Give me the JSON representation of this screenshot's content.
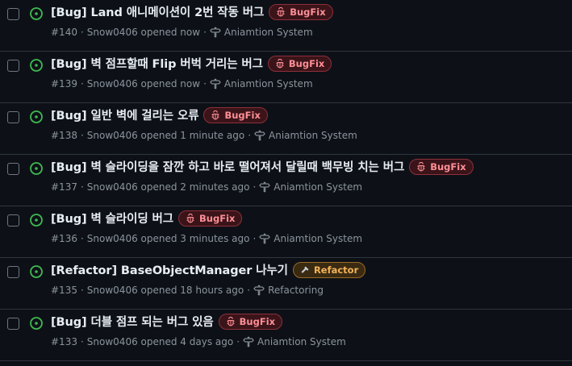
{
  "issues": [
    {
      "title": "[Bug] Land 애니메이션이 2번 작동 버그",
      "label": "BugFix",
      "label_type": "bug",
      "number": "#140",
      "opened_by": "Snow0406 opened now",
      "milestone": "Aniamtion System"
    },
    {
      "title": "[Bug] 벽 점프할때 Flip 버벅 거리는 버그",
      "label": "BugFix",
      "label_type": "bug",
      "number": "#139",
      "opened_by": "Snow0406 opened now",
      "milestone": "Aniamtion System"
    },
    {
      "title": "[Bug] 일반 벽에 걸리는 오류",
      "label": "BugFix",
      "label_type": "bug",
      "number": "#138",
      "opened_by": "Snow0406 opened 1 minute ago",
      "milestone": "Aniamtion System"
    },
    {
      "title": "[Bug] 벽 슬라이딩을 잠깐 하고 바로 떨어져서 달릴때 백무빙 치는 버그",
      "label": "BugFix",
      "label_type": "bug",
      "number": "#137",
      "opened_by": "Snow0406 opened 2 minutes ago",
      "milestone": "Aniamtion System"
    },
    {
      "title": "[Bug] 벽 슬라이딩 버그",
      "label": "BugFix",
      "label_type": "bug",
      "number": "#136",
      "opened_by": "Snow0406 opened 3 minutes ago",
      "milestone": "Aniamtion System"
    },
    {
      "title": "[Refactor] BaseObjectManager 나누기",
      "label": "Refactor",
      "label_type": "refactor",
      "number": "#135",
      "opened_by": "Snow0406 opened 18 hours ago",
      "milestone": "Refactoring"
    },
    {
      "title": "[Bug] 더블 점프 되는 버그 있음",
      "label": "BugFix",
      "label_type": "bug",
      "number": "#133",
      "opened_by": "Snow0406 opened 4 days ago",
      "milestone": "Aniamtion System"
    }
  ],
  "meta_separator": "·",
  "colors": {
    "background": "#0d1117",
    "open_status": "#3fb950",
    "bug_label": "#ff8f96",
    "refactor_label": "#f2b35a"
  },
  "icons": {
    "status": "issue-opened-icon",
    "bug": "bug-icon",
    "refactor": "hammer-icon",
    "milestone": "milestone-icon"
  }
}
